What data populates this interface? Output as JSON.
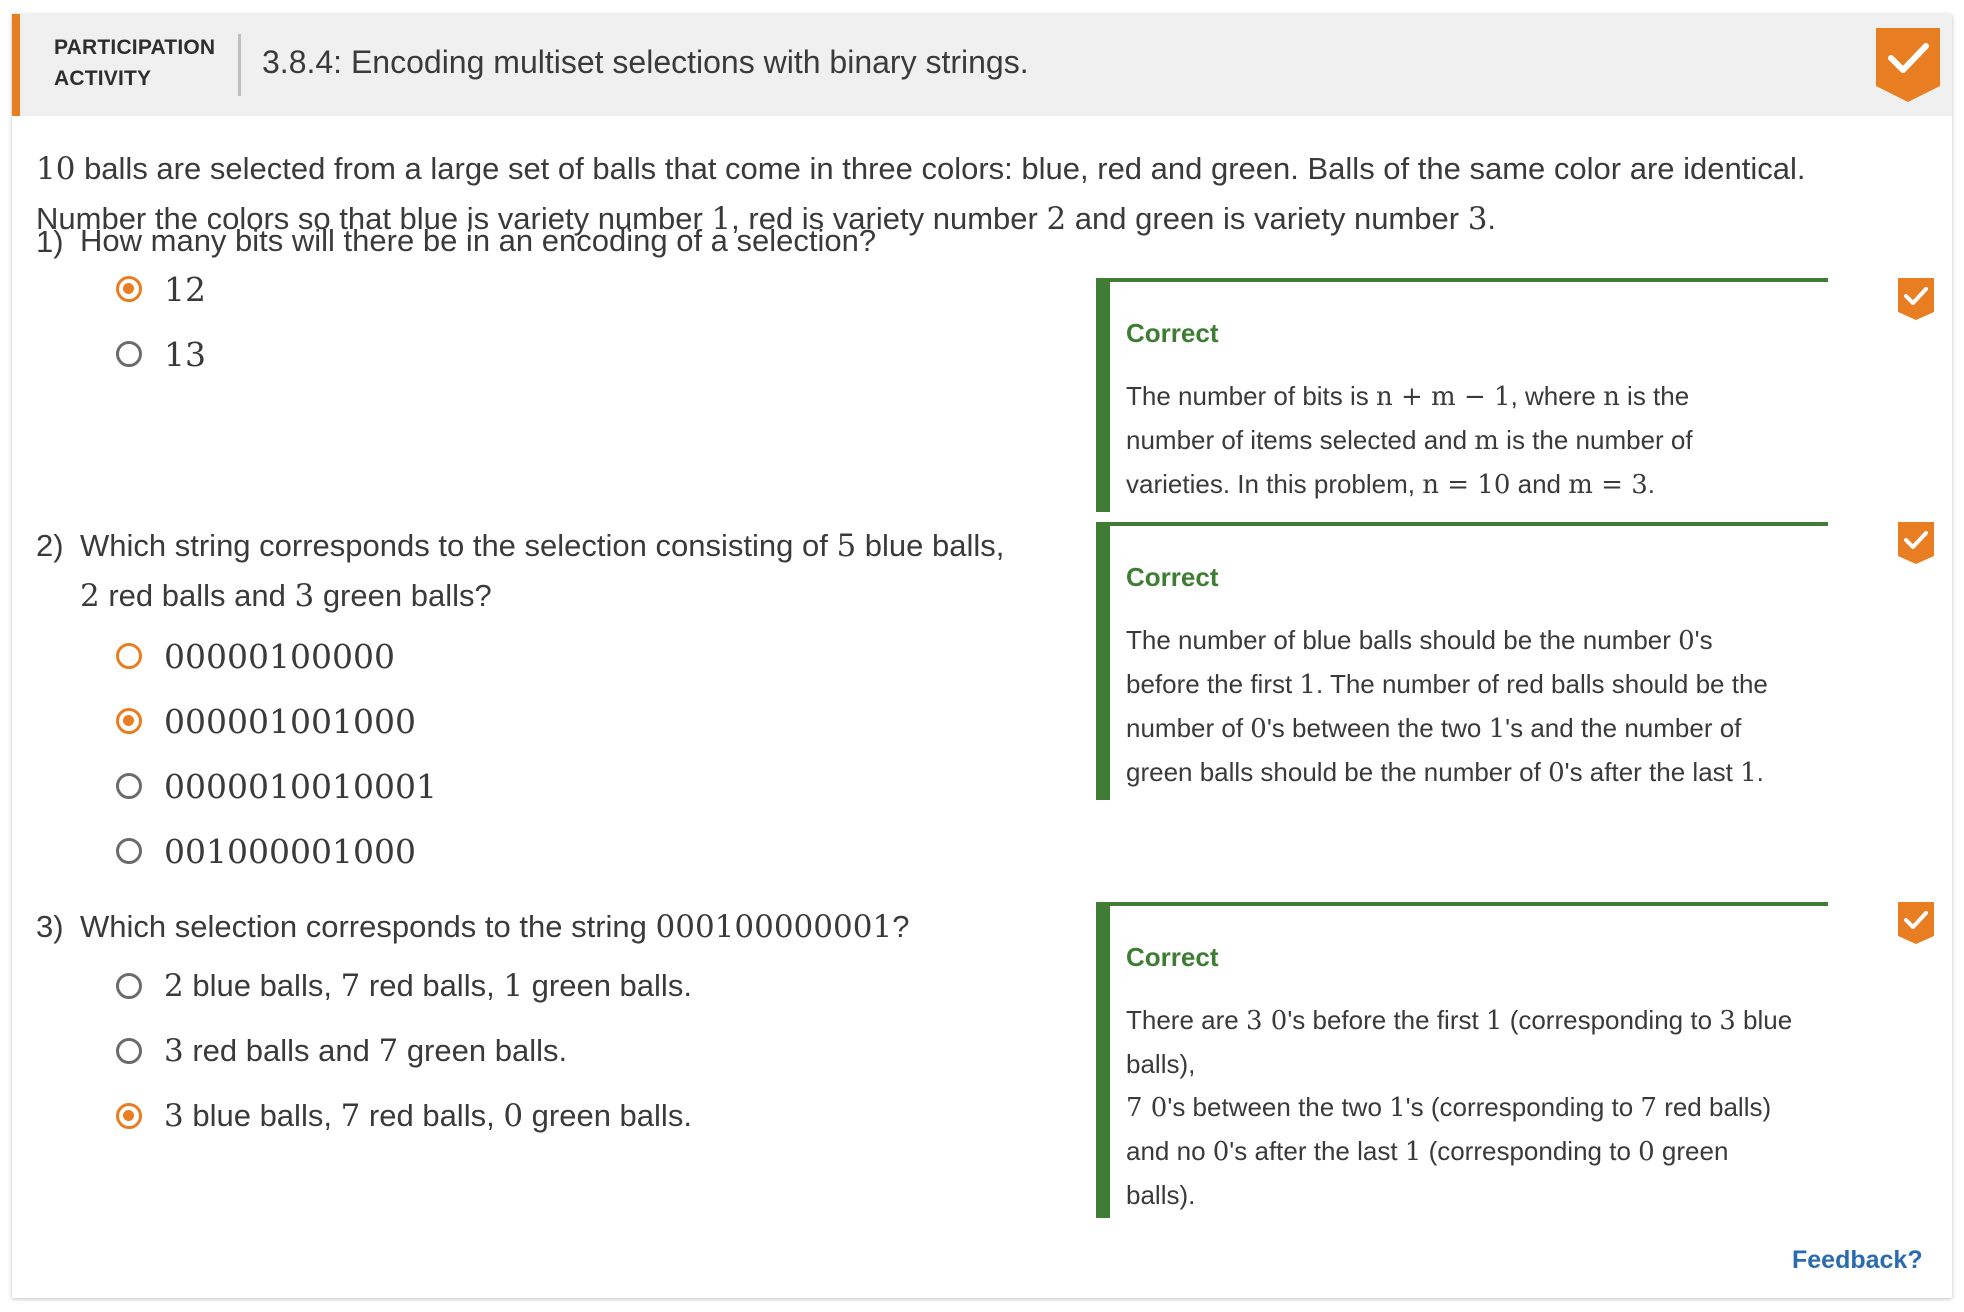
{
  "header": {
    "activity_label_line1": "PARTICIPATION",
    "activity_label_line2": "ACTIVITY",
    "title": "3.8.4: Encoding multiset selections with binary strings.",
    "badge_icon": "checkmark-icon"
  },
  "intro": {
    "n_balls": "10",
    "p1": " balls are selected from a large set of balls that come in three colors: blue, red and green. Balls of the same color are identical. Number the colors so that blue is variety number ",
    "v1": "1",
    "p2": ", red is variety number ",
    "v2": "2",
    "p3": " and green is variety number ",
    "v3": "3",
    "p4": "."
  },
  "questions": [
    {
      "number": "1)",
      "text": "How many bits will there be in an encoding of a selection?",
      "options": [
        {
          "label": "12",
          "selected": true
        },
        {
          "label": "13",
          "selected": false
        }
      ],
      "feedback": {
        "title": "Correct",
        "l1a": "The number of bits is ",
        "l1m": "n + m − 1",
        "l1b": ", where ",
        "l1n": "n",
        "l1c": " is the",
        "l2a": "number of items selected and ",
        "l2m": "m",
        "l2b": " is the number of",
        "l3a": "varieties. In this problem, ",
        "l3m1": "n = 10",
        "l3b": " and ",
        "l3m2": "m = 3",
        "l3c": "."
      }
    },
    {
      "number": "2)",
      "text_a": "Which string corresponds to the selection consisting of ",
      "text_m1": "5",
      "text_b": " blue balls,",
      "text_m2": "2",
      "text_c": " red balls and ",
      "text_m3": "3",
      "text_d": " green balls?",
      "options": [
        {
          "label": "00000100000",
          "selected": false
        },
        {
          "label": "000001001000",
          "selected": true
        },
        {
          "label": "0000010010001",
          "selected": false
        },
        {
          "label": "001000001000",
          "selected": false
        }
      ],
      "feedback": {
        "title": "Correct",
        "l1a": "The number of blue balls should be the number ",
        "l1m": "0",
        "l1b": "'s",
        "l2a": "before the first ",
        "l2m": "1",
        "l2b": ". The number of red balls should be the",
        "l3a": "number of ",
        "l3m1": "0",
        "l3b": "'s between the two ",
        "l3m2": "1",
        "l3c": "'s and the number of",
        "l4a": "green balls should be the number of ",
        "l4m1": "0",
        "l4b": "'s after the last ",
        "l4m2": "1",
        "l4c": "."
      }
    },
    {
      "number": "3)",
      "text_a": "Which selection corresponds to the string ",
      "text_m": "000100000001",
      "text_b": "?",
      "options": [
        {
          "m1": "2",
          "t1": " blue balls, ",
          "m2": "7",
          "t2": " red balls, ",
          "m3": "1",
          "t3": " green balls.",
          "selected": false
        },
        {
          "m1": "3",
          "t1": " red balls and ",
          "m2": "7",
          "t2": " green balls.",
          "selected": false
        },
        {
          "m1": "3",
          "t1": " blue balls, ",
          "m2": "7",
          "t2": " red balls, ",
          "m3": "0",
          "t3": " green balls.",
          "selected": true
        }
      ],
      "feedback": {
        "title": "Correct",
        "l1a": "There are ",
        "l1m1": "3 0",
        "l1b": "'s before the first ",
        "l1m2": "1",
        "l1c": " (corresponding to ",
        "l1m3": "3",
        "l1d": " blue",
        "l2": "balls),",
        "l3m1": "7 0",
        "l3a": "'s between the two ",
        "l3m2": "1",
        "l3b": "'s (corresponding to ",
        "l3m3": "7",
        "l3c": " red balls)",
        "l4a": "and no ",
        "l4m1": "0",
        "l4b": "'s after the last ",
        "l4m2": "1",
        "l4c": " (corresponding to ",
        "l4m3": "0",
        "l4d": " green",
        "l5": "balls)."
      }
    }
  ],
  "footer": {
    "feedback_link": "Feedback?"
  },
  "colors": {
    "accent": "#e87d22",
    "correct_green": "#3f7d34",
    "link_blue": "#2b6cb0"
  }
}
